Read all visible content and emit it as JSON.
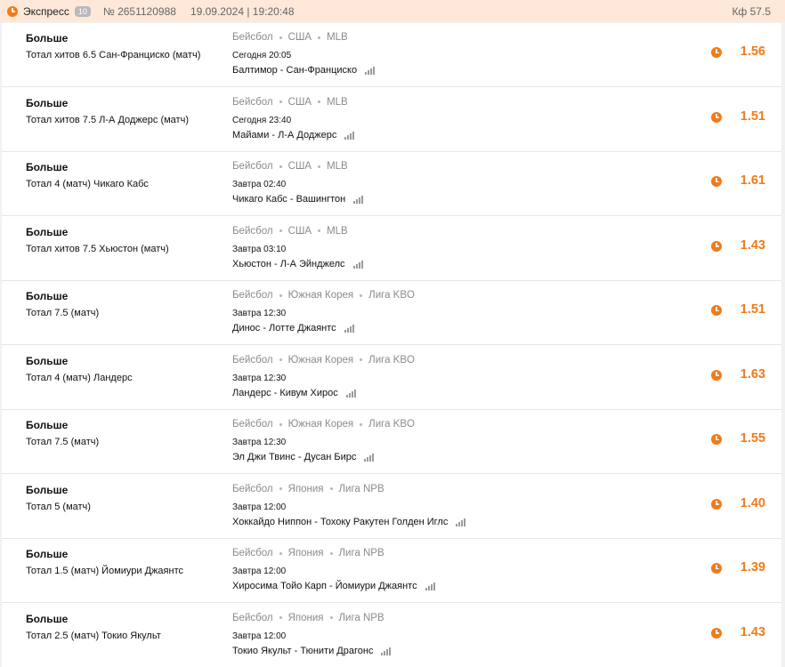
{
  "header": {
    "type": "Экспресс",
    "count": "10",
    "number": "№ 2651120988",
    "datetime": "19.09.2024 | 19:20:48",
    "total_odds": "Кф 57.5",
    "icon": "clock-icon",
    "accent_color": "#f07b1a",
    "background_color": "#fde8d9"
  },
  "bets": [
    {
      "outcome": "Больше",
      "market": "Тотал хитов 6.5 Сан-Франциско (матч)",
      "sport": "Бейсбол",
      "country": "США",
      "league": "MLB",
      "time": "Сегодня 20:05",
      "match": "Балтимор - Сан-Франциско",
      "odds": "1.56"
    },
    {
      "outcome": "Больше",
      "market": "Тотал хитов 7.5 Л-А Доджерс (матч)",
      "sport": "Бейсбол",
      "country": "США",
      "league": "MLB",
      "time": "Сегодня 23:40",
      "match": "Майами - Л-А Доджерс",
      "odds": "1.51"
    },
    {
      "outcome": "Больше",
      "market": "Тотал 4 (матч) Чикаго Кабс",
      "sport": "Бейсбол",
      "country": "США",
      "league": "MLB",
      "time": "Завтра 02:40",
      "match": "Чикаго Кабс - Вашингтон",
      "odds": "1.61"
    },
    {
      "outcome": "Больше",
      "market": "Тотал хитов 7.5 Хьюстон (матч)",
      "sport": "Бейсбол",
      "country": "США",
      "league": "MLB",
      "time": "Завтра 03:10",
      "match": "Хьюстон - Л-А Эйнджелс",
      "odds": "1.43"
    },
    {
      "outcome": "Больше",
      "market": "Тотал 7.5 (матч)",
      "sport": "Бейсбол",
      "country": "Южная Корея",
      "league": "Лига KBO",
      "time": "Завтра 12:30",
      "match": "Динос - Лотте Джаянтс",
      "odds": "1.51"
    },
    {
      "outcome": "Больше",
      "market": "Тотал 4 (матч) Ландерс",
      "sport": "Бейсбол",
      "country": "Южная Корея",
      "league": "Лига KBO",
      "time": "Завтра 12:30",
      "match": "Ландерс - Кивум Хирос",
      "odds": "1.63"
    },
    {
      "outcome": "Больше",
      "market": "Тотал 7.5 (матч)",
      "sport": "Бейсбол",
      "country": "Южная Корея",
      "league": "Лига KBO",
      "time": "Завтра 12:30",
      "match": "Эл Джи Твинс - Дусан Бирс",
      "odds": "1.55"
    },
    {
      "outcome": "Больше",
      "market": "Тотал 5 (матч)",
      "sport": "Бейсбол",
      "country": "Япония",
      "league": "Лига NPB",
      "time": "Завтра 12:00",
      "match": "Хоккайдо Ниппон - Тохоку Ракутен Голден Иглс",
      "odds": "1.40"
    },
    {
      "outcome": "Больше",
      "market": "Тотал 1.5 (матч) Йомиури Джаянтс",
      "sport": "Бейсбол",
      "country": "Япония",
      "league": "Лига NPB",
      "time": "Завтра 12:00",
      "match": "Хиросима Тойо Карп - Йомиури Джаянтс",
      "odds": "1.39"
    },
    {
      "outcome": "Больше",
      "market": "Тотал 2.5 (матч) Токио Якульт",
      "sport": "Бейсбол",
      "country": "Япония",
      "league": "Лига NPB",
      "time": "Завтра 12:00",
      "match": "Токио Якульт - Тюнити Драгонс",
      "odds": "1.43"
    }
  ]
}
